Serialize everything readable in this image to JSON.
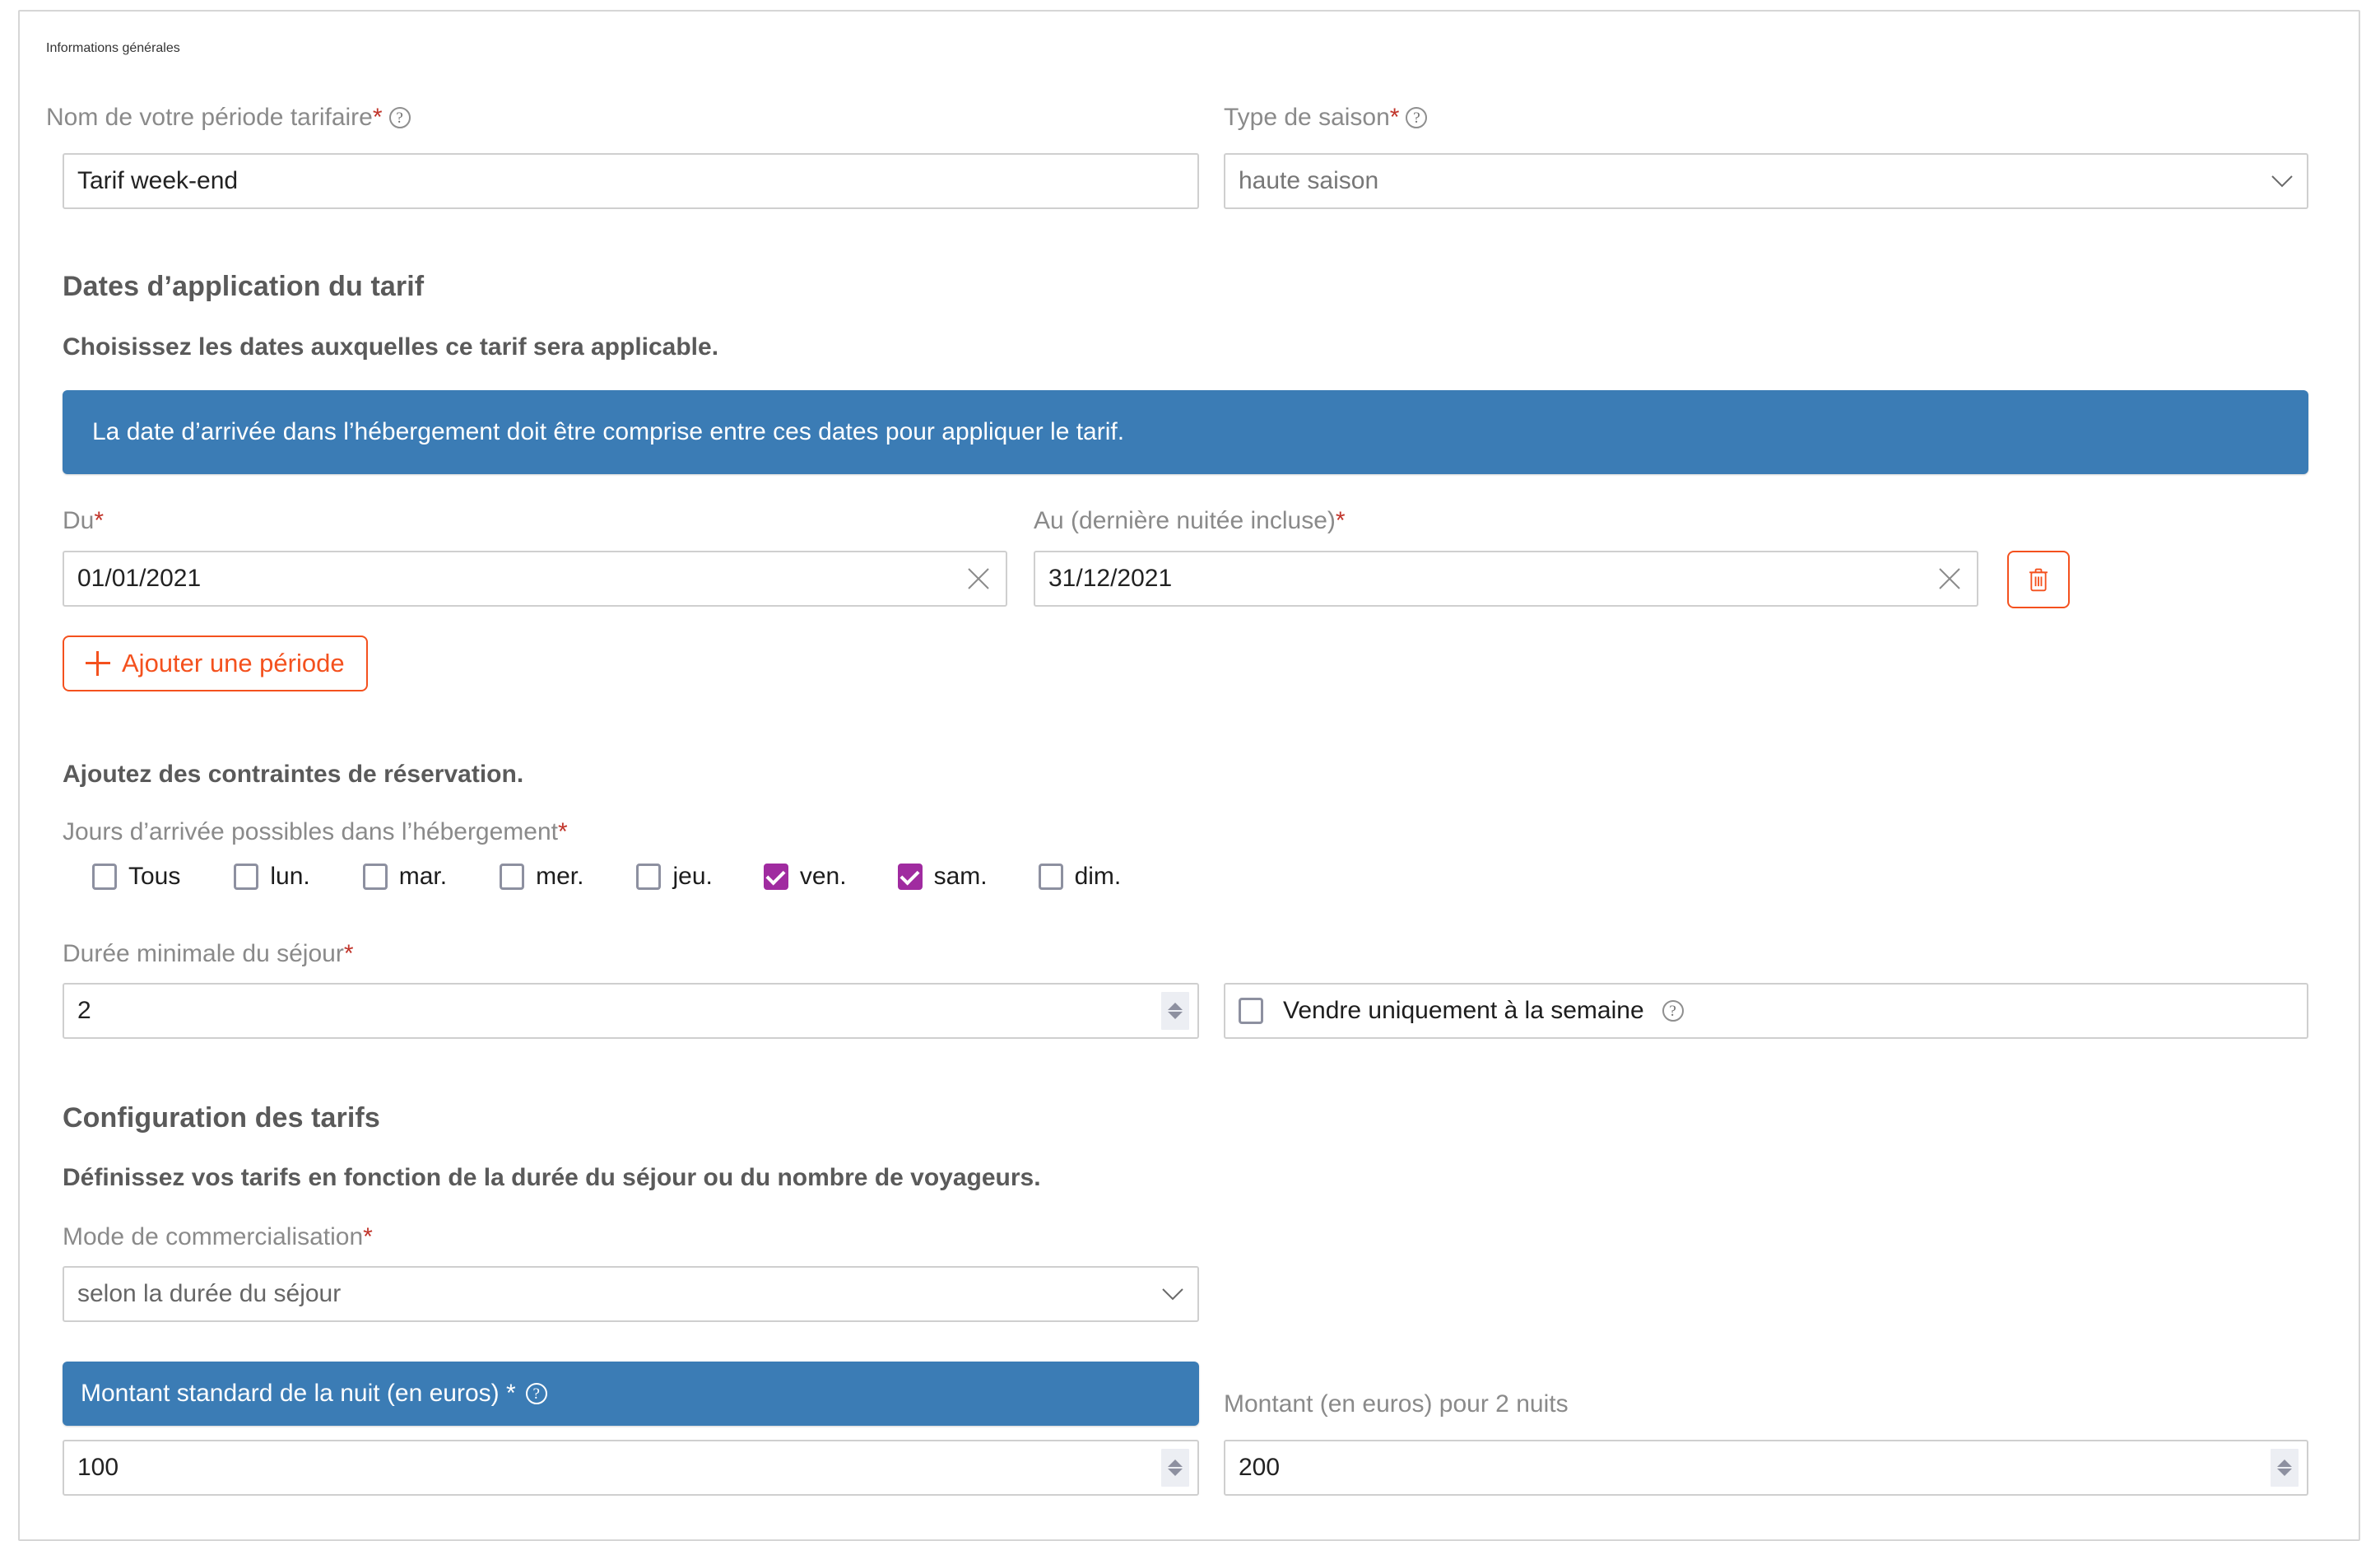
{
  "sections": {
    "general": {
      "title": "Informations générales",
      "name_label": "Nom de votre période tarifaire",
      "name_value": "Tarif week-end",
      "season_label": "Type de saison",
      "season_value": "haute saison"
    },
    "dates": {
      "title": "Dates d’application du tarif",
      "subtitle": "Choisissez les dates auxquelles ce tarif sera applicable.",
      "banner": "La date d’arrivée dans l’hébergement doit être comprise entre ces dates pour appliquer le tarif.",
      "from_label": "Du",
      "from_value": "01/01/2021",
      "to_label": "Au (dernière nuitée incluse)",
      "to_value": "31/12/2021",
      "add_period_label": "Ajouter une période"
    },
    "constraints": {
      "subtitle": "Ajoutez des contraintes de réservation.",
      "days_label": "Jours d’arrivée possibles dans l’hébergement",
      "days": [
        {
          "label": "Tous",
          "checked": false
        },
        {
          "label": "lun.",
          "checked": false
        },
        {
          "label": "mar.",
          "checked": false
        },
        {
          "label": "mer.",
          "checked": false
        },
        {
          "label": "jeu.",
          "checked": false
        },
        {
          "label": "ven.",
          "checked": true
        },
        {
          "label": "sam.",
          "checked": true
        },
        {
          "label": "dim.",
          "checked": false
        }
      ],
      "min_stay_label": "Durée minimale du séjour",
      "min_stay_value": "2",
      "week_only_label": "Vendre uniquement à la semaine",
      "week_only_checked": false
    },
    "pricing": {
      "title": "Configuration des tarifs",
      "subtitle": "Définissez vos tarifs en fonction de la durée du séjour ou du nombre de voyageurs.",
      "mode_label": "Mode de commercialisation",
      "mode_value": "selon la durée du séjour",
      "standard_label": "Montant standard de la nuit (en euros) *",
      "standard_value": "100",
      "two_nights_label": "Montant (en euros) pour 2 nuits",
      "two_nights_value": "200"
    }
  },
  "colors": {
    "accent_orange": "#f4511e",
    "banner_blue": "#3b7cb5",
    "checkbox_purple": "#a02ba0",
    "required_red": "#c1352b"
  }
}
